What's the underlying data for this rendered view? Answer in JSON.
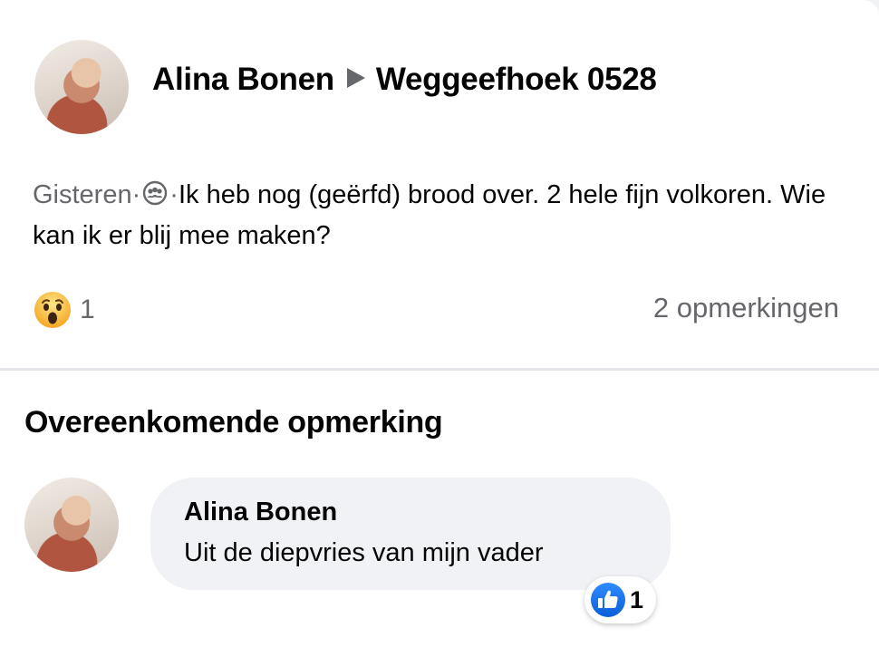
{
  "post": {
    "author": "Alina Bonen",
    "group": "Weggeefhoek 0528",
    "time": "Gisteren",
    "separator": "·",
    "audience_icon": "group-audience-icon",
    "text": "Ik heb nog (geërfd) brood over. 2 hele fijn volkoren. Wie kan ik er blij mee maken?",
    "reaction_icon": "wow-reaction-icon",
    "reaction_count": "1",
    "comments_label": "2 opmerkingen"
  },
  "comment_section": {
    "title": "Overeenkomende opmerking",
    "comment": {
      "author": "Alina Bonen",
      "text": "Uit de diepvries van mijn vader",
      "reaction_icon": "like-reaction-icon",
      "reaction_count": "1"
    }
  },
  "colors": {
    "text_primary": "#050505",
    "text_secondary": "#65676b",
    "bubble_bg": "#f0f2f5",
    "like_blue": "#1877f2",
    "wow_yellow": "#f7b125"
  }
}
